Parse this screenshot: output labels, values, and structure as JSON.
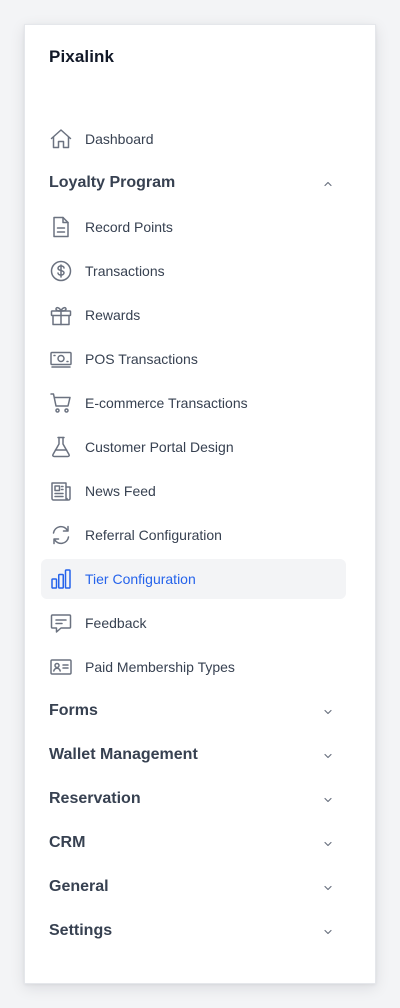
{
  "app": {
    "brand": "Pixalink"
  },
  "colors": {
    "accent": "#2563eb",
    "text": "#374151",
    "icon": "#6b7280",
    "active_bg": "#f3f4f6"
  },
  "nav": {
    "dashboard": {
      "label": "Dashboard",
      "icon": "home-icon"
    },
    "loyalty": {
      "label": "Loyalty Program",
      "expanded": true,
      "items": [
        {
          "label": "Record Points",
          "icon": "document-icon"
        },
        {
          "label": "Transactions",
          "icon": "dollar-circle-icon"
        },
        {
          "label": "Rewards",
          "icon": "gift-icon"
        },
        {
          "label": "POS Transactions",
          "icon": "cash-icon"
        },
        {
          "label": "E-commerce Transactions",
          "icon": "cart-icon"
        },
        {
          "label": "Customer Portal Design",
          "icon": "beaker-icon"
        },
        {
          "label": "News Feed",
          "icon": "newspaper-icon"
        },
        {
          "label": "Referral Configuration",
          "icon": "refresh-icon"
        },
        {
          "label": "Tier Configuration",
          "icon": "bar-chart-icon",
          "active": true
        },
        {
          "label": "Feedback",
          "icon": "chat-icon"
        },
        {
          "label": "Paid Membership Types",
          "icon": "id-card-icon"
        }
      ]
    },
    "groups": [
      {
        "label": "Forms"
      },
      {
        "label": "Wallet Management"
      },
      {
        "label": "Reservation"
      },
      {
        "label": "CRM"
      },
      {
        "label": "General"
      },
      {
        "label": "Settings"
      }
    ]
  }
}
